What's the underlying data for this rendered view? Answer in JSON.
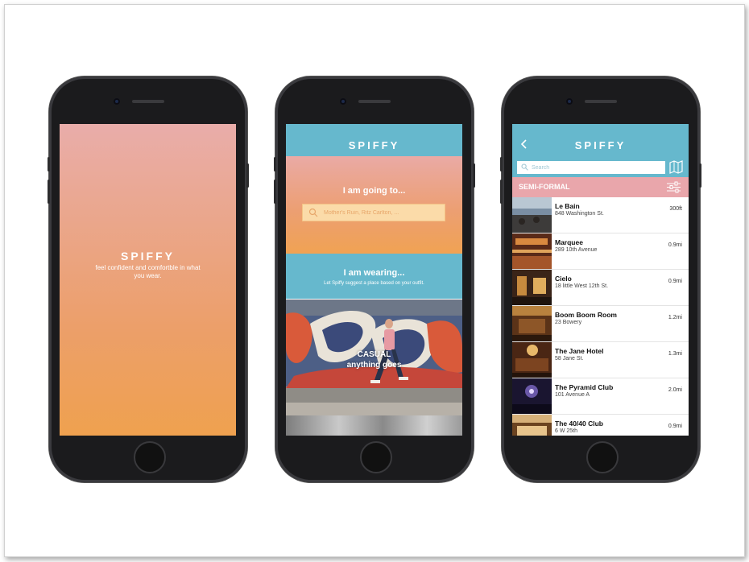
{
  "phone1": {
    "logo": "SPIFFY",
    "tagline": "feel confident and comfortble in what you wear."
  },
  "phone2": {
    "header_title": "SPIFFY",
    "going_label": "I am going to...",
    "search_placeholder": "Mother's Ruin, Ritz Carlton, ...",
    "wearing_label": "I am wearing...",
    "wearing_sub": "Let Spiffy suggest a place based on your outfit.",
    "casual_title": "CASUAL",
    "casual_sub": "anything goes"
  },
  "phone3": {
    "header_title": "SPIFFY",
    "search_placeholder": "Search",
    "filter_label": "SEMI-FORMAL",
    "venues": [
      {
        "name": "Le Bain",
        "address": "848 Washington St.",
        "distance": "300ft"
      },
      {
        "name": "Marquee",
        "address": "289 10th Avenue",
        "distance": "0.9mi"
      },
      {
        "name": "Cielo",
        "address": "18 little West 12th St.",
        "distance": "0.9mi"
      },
      {
        "name": "Boom Boom Room",
        "address": "23 Bowery",
        "distance": "1.2mi"
      },
      {
        "name": "The Jane Hotel",
        "address": "58 Jane St.",
        "distance": "1.3mi"
      },
      {
        "name": "The Pyramid Club",
        "address": "101 Avenue A",
        "distance": "2.0mi"
      },
      {
        "name": "The 40/40 Club",
        "address": "6 W 25th",
        "distance": "0.9mi"
      }
    ]
  },
  "colors": {
    "header_blue": "#66b8cd",
    "filter_pink": "#e9a6ab",
    "gradient_top": "#e9adaa",
    "gradient_bottom": "#efa14f"
  },
  "icons": [
    "search-icon",
    "back-chevron-icon",
    "map-icon",
    "filter-sliders-icon"
  ]
}
